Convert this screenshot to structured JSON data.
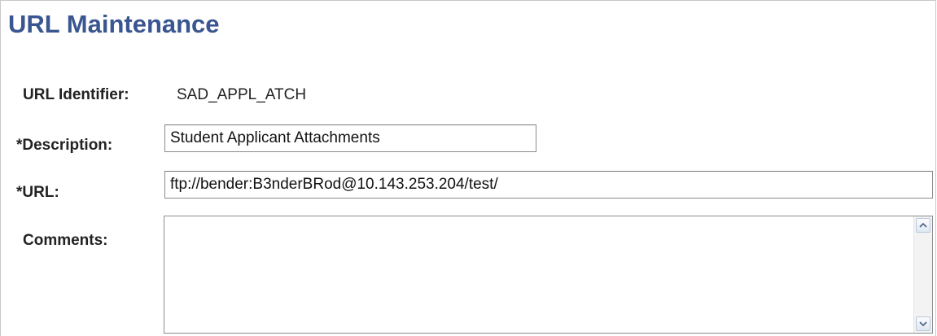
{
  "page": {
    "title": "URL Maintenance"
  },
  "form": {
    "url_identifier": {
      "label": "URL Identifier:",
      "value": "SAD_APPL_ATCH"
    },
    "description": {
      "label": "*Description:",
      "value": "Student Applicant Attachments"
    },
    "url": {
      "label": "*URL:",
      "value": "ftp://bender:B3nderBRod@10.143.253.204/test/"
    },
    "comments": {
      "label": "Comments:",
      "value": ""
    }
  },
  "icons": {
    "scroll_up": "chevron-up-icon",
    "scroll_down": "chevron-down-icon"
  },
  "colors": {
    "title": "#3a5690",
    "label": "#222222",
    "input_border": "#8c8c8c"
  }
}
